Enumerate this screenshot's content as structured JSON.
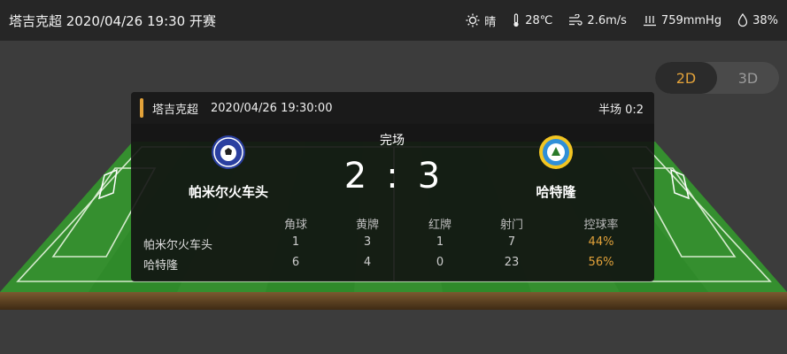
{
  "header": {
    "title": "塔吉克超 2020/04/26 19:30 开赛",
    "weather": {
      "condition": "晴",
      "temperature": "28℃",
      "wind": "2.6m/s",
      "pressure": "759mmHg",
      "humidity": "38%"
    }
  },
  "view_toggle": {
    "option_2d": "2D",
    "option_3d": "3D",
    "active": "2D"
  },
  "match_card": {
    "league": "塔吉克超",
    "datetime": "2020/04/26 19:30:00",
    "half_score": "半场 0:2",
    "status": "完场",
    "home": {
      "name": "帕米尔火车头",
      "score": "2"
    },
    "away": {
      "name": "哈特隆",
      "score": "3"
    },
    "separator": ":",
    "stats": {
      "headers": [
        "角球",
        "黄牌",
        "红牌",
        "射门",
        "控球率"
      ],
      "rows": [
        {
          "team": "帕米尔火车头",
          "values": [
            "1",
            "3",
            "1",
            "7",
            "44%"
          ]
        },
        {
          "team": "哈特隆",
          "values": [
            "6",
            "4",
            "0",
            "23",
            "56%"
          ]
        }
      ]
    }
  },
  "colors": {
    "accent": "#e2a23a",
    "pitch": "#2f8a2a",
    "topbar": "#262626"
  },
  "icons": [
    "sun-icon",
    "thermometer-icon",
    "wind-icon",
    "pressure-icon",
    "humidity-icon"
  ]
}
